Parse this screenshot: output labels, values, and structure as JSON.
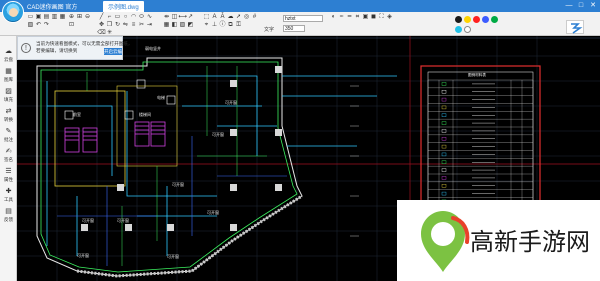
{
  "window": {
    "app_name": "CAD迷你画图 官方",
    "file_tab": "示例图.dwg",
    "controls": [
      "—",
      "□",
      "✕"
    ]
  },
  "toolbar": {
    "text_label": "文字",
    "font_value": "hztxt",
    "size_value": "350",
    "colors": [
      "#1a1a1a",
      "#ffd400",
      "#ff2020",
      "#3c5cff",
      "#00aa44",
      "#22c2e8",
      "#ffffff"
    ]
  },
  "sidebar": {
    "items": [
      {
        "label": "云盘",
        "icon": "cloud-icon"
      },
      {
        "label": "图库",
        "icon": "gallery-icon"
      },
      {
        "label": "填充",
        "icon": "fill-icon"
      },
      {
        "label": "转换",
        "icon": "convert-icon"
      },
      {
        "label": "批注",
        "icon": "comment-icon"
      },
      {
        "label": "签名",
        "icon": "signature-icon"
      },
      {
        "label": "属性",
        "icon": "properties-icon"
      },
      {
        "label": "工具",
        "icon": "tools-icon"
      },
      {
        "label": "反馈",
        "icon": "feedback-icon"
      }
    ]
  },
  "notice": {
    "line1": "当前为快速看图模式，可以无需全部打开图纸，",
    "line2": "若要编辑，请切换到",
    "button": "开启云编"
  },
  "drawing": {
    "labels": [
      "弱电竖井",
      "可开窗",
      "可开窗",
      "可开窗",
      "可开窗",
      "可开窗",
      "可开窗",
      "可开窗",
      "可开窗",
      "电梯",
      "楼梯间",
      "前室"
    ]
  },
  "legend_table": {
    "title": "图例材料表",
    "rows": 24
  },
  "watermark": {
    "site_name": "高新手游网"
  }
}
